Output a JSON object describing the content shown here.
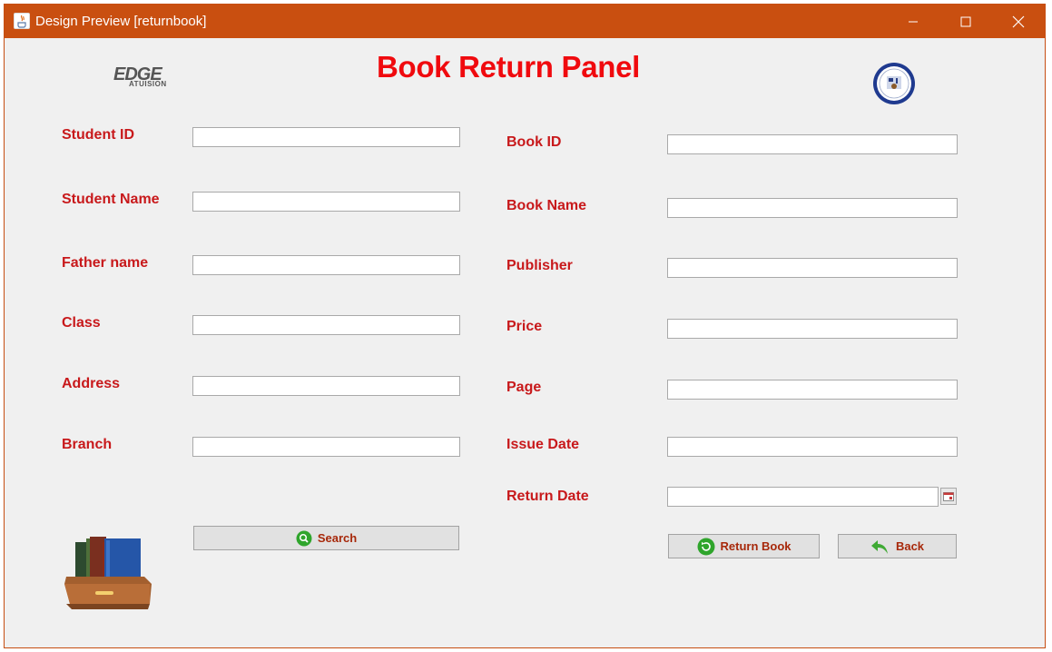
{
  "window": {
    "title": "Design Preview [returnbook]"
  },
  "header": {
    "title": "Book Return Panel",
    "logo_text": "EDGE",
    "logo_subtext": "ATUISION"
  },
  "student": {
    "student_id_label": "Student ID",
    "student_name_label": "Student Name",
    "father_name_label": "Father name",
    "class_label": "Class",
    "address_label": "Address",
    "branch_label": "Branch",
    "search_label": "Search"
  },
  "book": {
    "book_id_label": "Book ID",
    "book_name_label": "Book Name",
    "publisher_label": "Publisher",
    "price_label": "Price",
    "page_label": "Page",
    "issue_date_label": "Issue Date",
    "return_date_label": "Return Date",
    "return_book_label": "Return Book",
    "back_label": "Back"
  },
  "colors": {
    "titlebar": "#c94f10",
    "label_red": "#c8191b",
    "title_red": "#f00a0e",
    "button_text": "#a7280a",
    "icon_green": "#2fa52c"
  },
  "icons": [
    "java-app-icon",
    "minimize-icon",
    "maximize-icon",
    "close-icon",
    "search-icon",
    "return-icon",
    "back-arrow-icon",
    "calendar-icon",
    "books-icon",
    "emblem-logo"
  ]
}
